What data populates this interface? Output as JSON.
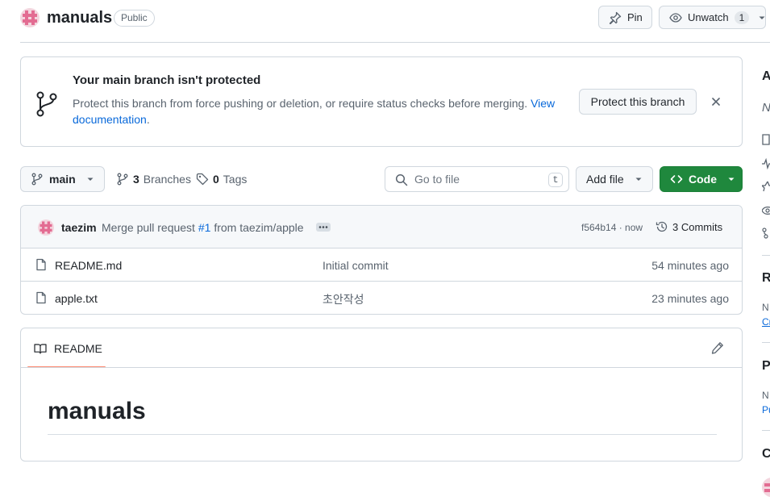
{
  "repo": {
    "name": "manuals",
    "visibility": "Public"
  },
  "header_actions": {
    "pin_label": "Pin",
    "unwatch_label": "Unwatch",
    "watch_count": "1"
  },
  "banner": {
    "title": "Your main branch isn't protected",
    "text": "Protect this branch from force pushing or deletion, or require status checks before merging.",
    "link_text_1": "View",
    "link_text_2": "documentation",
    "link_tail": ".",
    "action_label": "Protect this branch"
  },
  "toolbar": {
    "branch": "main",
    "branches_count": "3",
    "branches_label": "Branches",
    "tags_count": "0",
    "tags_label": "Tags",
    "search_placeholder": "Go to file",
    "search_shortcut": "t",
    "add_file_label": "Add file",
    "code_label": "Code"
  },
  "latest_commit": {
    "author": "taezim",
    "message_prefix": "Merge pull request",
    "pr_link": "#1",
    "message_suffix": "from taezim/apple",
    "sha_time": "f564b14 · now",
    "commits_label": "3 Commits"
  },
  "files": [
    {
      "name": "README.md",
      "message": "Initial commit",
      "time": "54 minutes ago"
    },
    {
      "name": "apple.txt",
      "message": "초안작성",
      "time": "23 minutes ago"
    }
  ],
  "readme": {
    "tab_label": "README",
    "heading": "manuals"
  },
  "sidebar_peek": {
    "about_letter": "A",
    "about_desc_letter": "N",
    "releases_letter": "R",
    "releases_text": "N",
    "releases_link": "Cr",
    "packages_letter": "P",
    "packages_text": "N",
    "packages_link": "Pu",
    "contributors_letter": "C"
  },
  "colors": {
    "accent_green": "#1f883d",
    "link_blue": "#0969da",
    "underline_orange": "#fd8c73",
    "avatar_pink": "#e36c92"
  }
}
